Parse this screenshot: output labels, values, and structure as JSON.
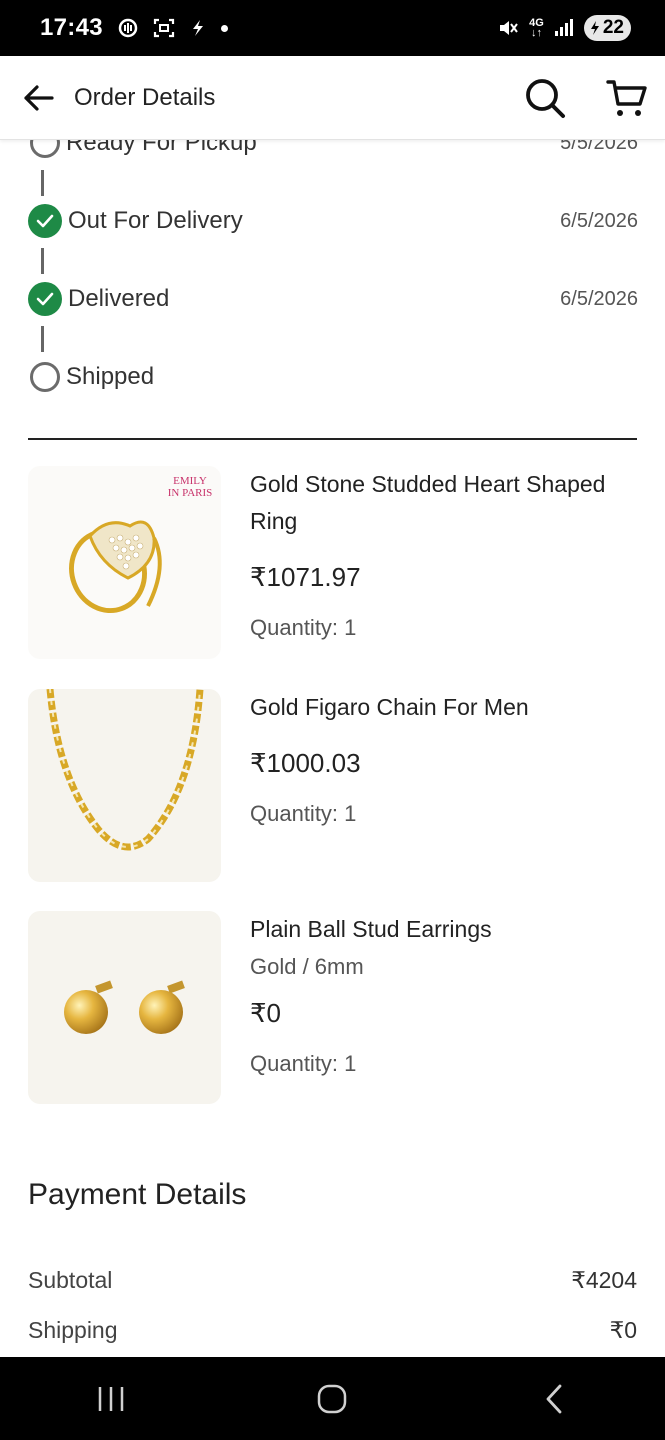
{
  "status_bar": {
    "time": "17:43",
    "network": "4G",
    "battery": "22"
  },
  "header": {
    "title": "Order Details"
  },
  "timeline": [
    {
      "label": "Ready For Pickup",
      "date": "5/5/2026",
      "state": "pending"
    },
    {
      "label": "Out For Delivery",
      "date": "6/5/2026",
      "state": "done"
    },
    {
      "label": "Delivered",
      "date": "6/5/2026",
      "state": "done"
    },
    {
      "label": "Shipped",
      "date": "",
      "state": "pending"
    }
  ],
  "products": [
    {
      "name": "Gold Stone Studded Heart Shaped Ring",
      "variant": "",
      "price": "₹1071.97",
      "quantity": "Quantity: 1",
      "image_icon": "heart-ring-image",
      "brand_mark": "EMILY IN PARIS"
    },
    {
      "name": "Gold Figaro Chain For Men",
      "variant": "",
      "price": "₹1000.03",
      "quantity": "Quantity: 1",
      "image_icon": "figaro-chain-image"
    },
    {
      "name": "Plain Ball Stud Earrings",
      "variant": "Gold / 6mm",
      "price": "₹0",
      "quantity": "Quantity: 1",
      "image_icon": "ball-stud-earrings-image"
    }
  ],
  "payment": {
    "title": "Payment Details",
    "rows": [
      {
        "label": "Subtotal",
        "value": "₹4204"
      },
      {
        "label": "Shipping",
        "value": "₹0"
      }
    ]
  },
  "colors": {
    "done": "#1e8a46",
    "gold": "#d8a826"
  }
}
